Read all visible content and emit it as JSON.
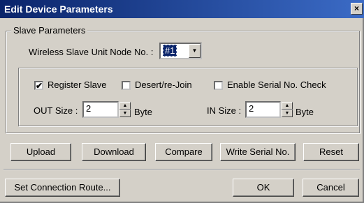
{
  "window": {
    "title": "Edit Device Parameters",
    "close_label": "×"
  },
  "slave_parameters": {
    "group_label": "Slave Parameters",
    "node_no_label": "Wireless Slave Unit Node No. :",
    "node_no_value": "#1"
  },
  "options": {
    "register_slave": {
      "label": "Register Slave",
      "checked": true,
      "mark": "✔"
    },
    "desert_rejoin": {
      "label": "Desert/re-Join",
      "checked": false
    },
    "enable_serial_check": {
      "label": "Enable Serial No. Check",
      "checked": false
    }
  },
  "out_size": {
    "label": "OUT Size :",
    "value": "2",
    "unit": "Byte"
  },
  "in_size": {
    "label": "IN Size :",
    "value": "2",
    "unit": "Byte"
  },
  "buttons": {
    "upload": "Upload",
    "download": "Download",
    "compare": "Compare",
    "write_serial": "Write Serial No.",
    "reset": "Reset",
    "set_route": "Set Connection Route...",
    "ok": "OK",
    "cancel": "Cancel"
  },
  "icons": {
    "spin_up": "▲",
    "spin_down": "▼",
    "dropdown": "▼"
  }
}
